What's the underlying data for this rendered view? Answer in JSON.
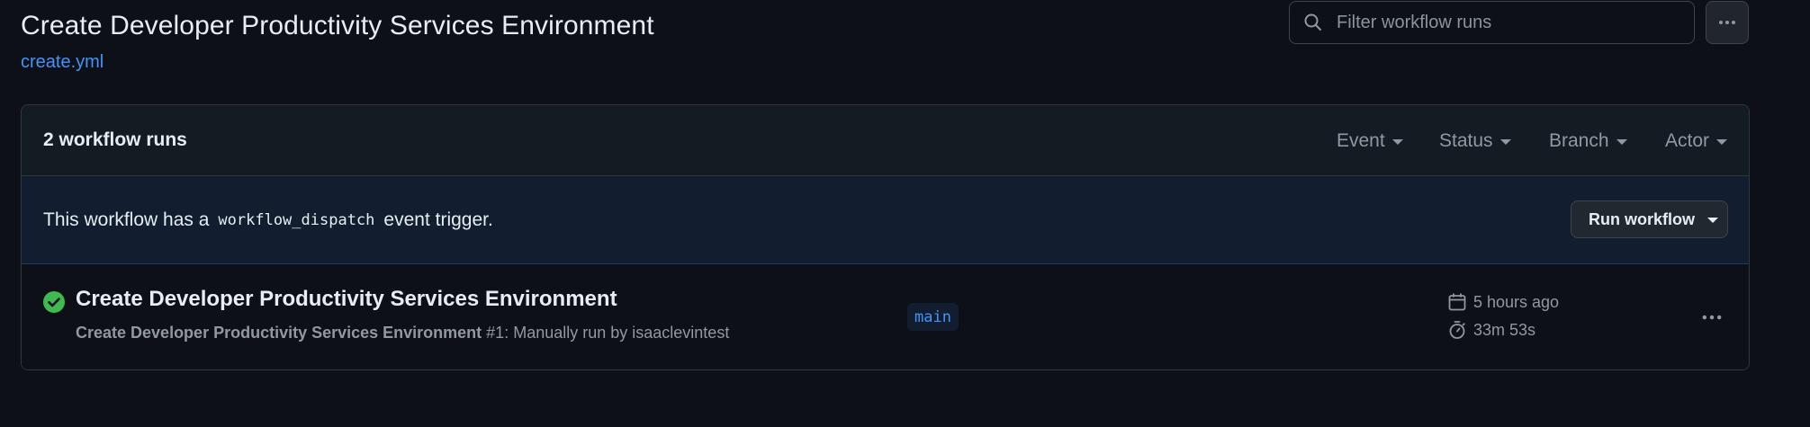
{
  "header": {
    "title": "Create Developer Productivity Services Environment",
    "file_link": "create.yml"
  },
  "search": {
    "placeholder": "Filter workflow runs"
  },
  "panel": {
    "runs_count": "2 workflow runs",
    "filters": [
      {
        "label": "Event"
      },
      {
        "label": "Status"
      },
      {
        "label": "Branch"
      },
      {
        "label": "Actor"
      }
    ],
    "dispatch": {
      "prefix": "This workflow has a",
      "code": "workflow_dispatch",
      "suffix": "event trigger.",
      "run_button": "Run workflow"
    },
    "runs": [
      {
        "status": "success",
        "status_icon": "check-circle-icon",
        "title": "Create Developer Productivity Services Environment",
        "workflow_name": "Create Developer Productivity Services Environment",
        "detail": " #1: Manually run by isaaclevintest",
        "branch": "main",
        "time_ago": "5 hours ago",
        "duration": "33m 53s"
      }
    ]
  },
  "colors": {
    "background": "#0d1117",
    "link": "#4493f8",
    "success": "#3fb950",
    "muted": "#9198a1",
    "dispatch_bg": "#121d2f"
  }
}
